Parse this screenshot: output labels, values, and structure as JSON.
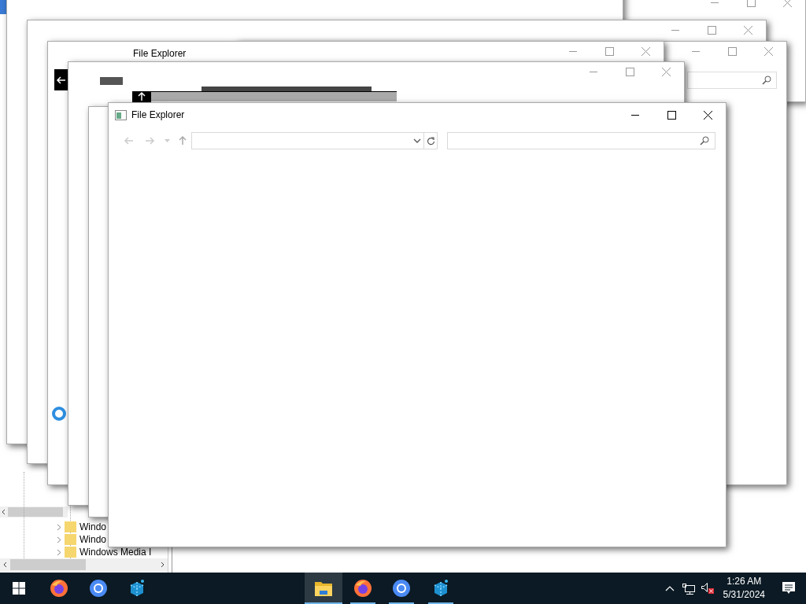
{
  "back_window": {
    "title": "File Explorer"
  },
  "front_window": {
    "title": "File Explorer"
  },
  "tree": {
    "items": [
      "Windo",
      "Windo",
      "Windows Media I"
    ]
  },
  "taskbar": {
    "apps": [
      {
        "kind": "firefox",
        "running": false,
        "selected": false
      },
      {
        "kind": "chromium",
        "running": false,
        "selected": false
      },
      {
        "kind": "cube",
        "running": false,
        "selected": false
      },
      {
        "kind": "explorer",
        "running": true,
        "selected": true
      },
      {
        "kind": "firefox",
        "running": true,
        "selected": false
      },
      {
        "kind": "chromium",
        "running": true,
        "selected": false
      },
      {
        "kind": "cube",
        "running": true,
        "selected": false
      }
    ],
    "volume_muted": true,
    "time": "1:26 AM",
    "date": "5/31/2024"
  }
}
